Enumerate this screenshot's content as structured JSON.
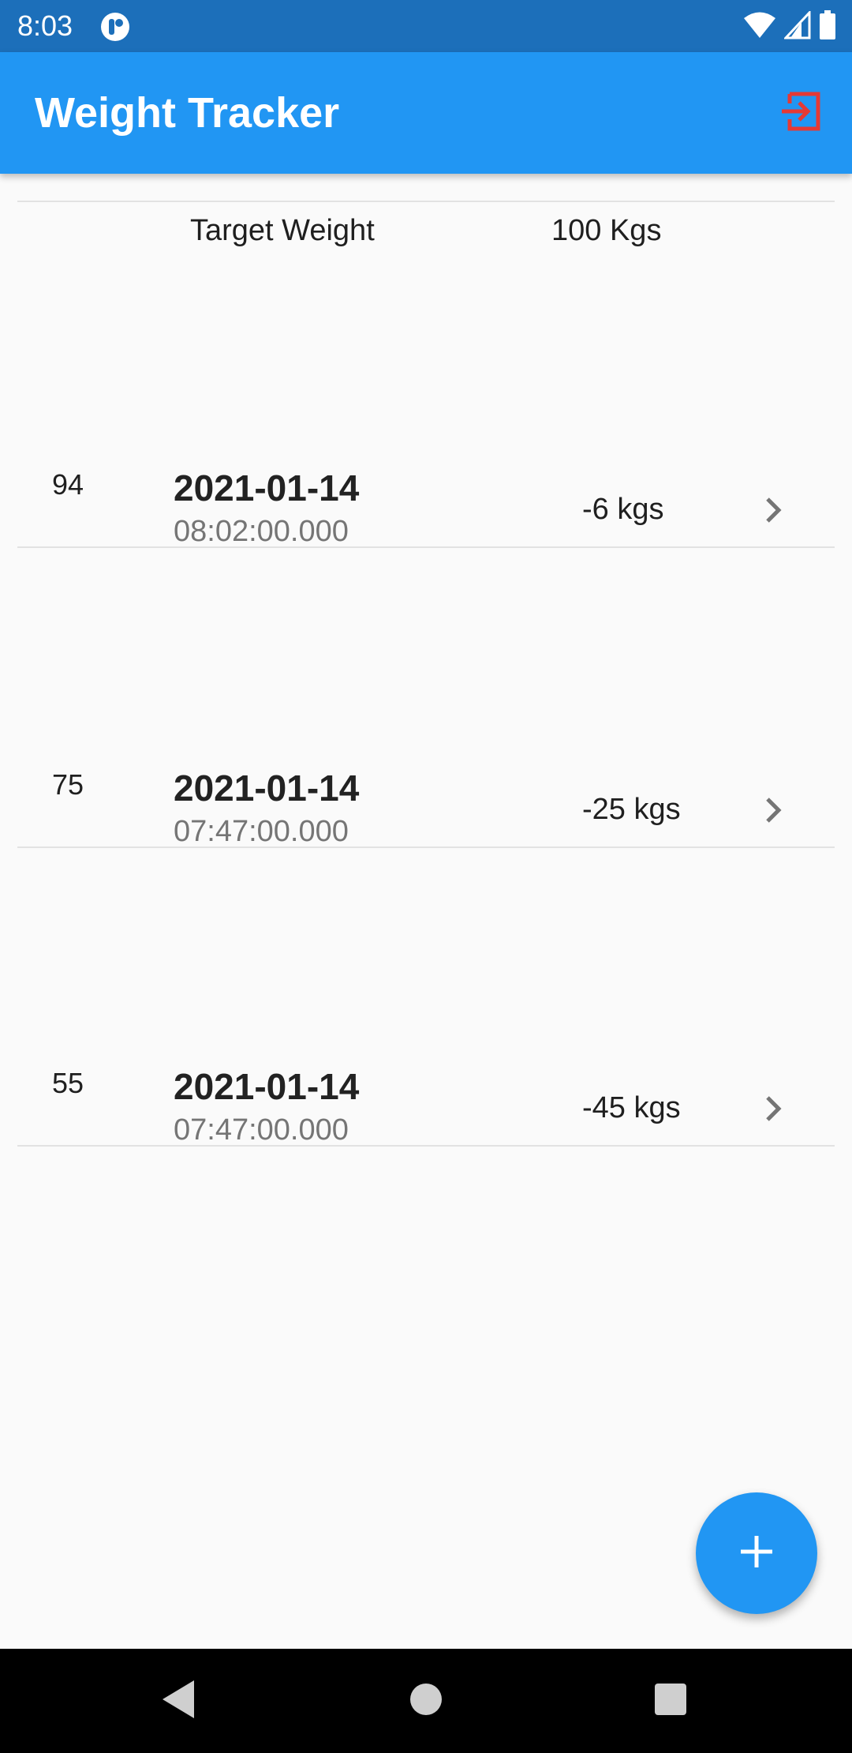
{
  "status_bar": {
    "time": "8:03",
    "app_icon": "app-notification-icon",
    "icons": [
      "wifi-icon",
      "cell-signal-icon",
      "battery-icon"
    ]
  },
  "app_bar": {
    "title": "Weight Tracker",
    "action_icon": "logout-icon",
    "background": "#2196f3",
    "action_color": "#e53935"
  },
  "target": {
    "label": "Target Weight",
    "value": "100 Kgs"
  },
  "entries": [
    {
      "weight": "94",
      "date": "2021-01-14",
      "time": "08:02:00.000",
      "diff": "-6 kgs"
    },
    {
      "weight": "75",
      "date": "2021-01-14",
      "time": "07:47:00.000",
      "diff": "-25 kgs"
    },
    {
      "weight": "55",
      "date": "2021-01-14",
      "time": "07:47:00.000",
      "diff": "-45 kgs"
    }
  ],
  "fab": {
    "icon": "plus-icon",
    "color": "#2196f3"
  },
  "nav_bar": {
    "icons": [
      "back-icon",
      "home-icon",
      "recents-icon"
    ]
  }
}
